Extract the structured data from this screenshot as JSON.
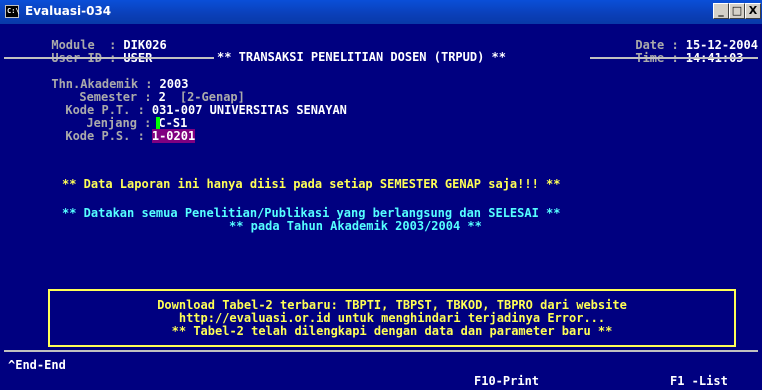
{
  "window": {
    "title": "Evaluasi-034",
    "icon_text": "C:\\",
    "minimize": "_",
    "maximize": "□",
    "close": "X"
  },
  "header": {
    "module_label": "Module  :",
    "module_value": "DIK026",
    "user_label": "User ID :",
    "user_value": "USER",
    "date_label": "Date :",
    "date_value": "15-12-2004",
    "time_label": "Time :",
    "time_value": "14:41:03",
    "screen_title": "** TRANSAKSI PENELITIAN DOSEN (TRPUD) **"
  },
  "form": {
    "thn_label": "Thn.Akademik :",
    "thn_value": "2003",
    "semester_label": "Semester :",
    "semester_value": "2",
    "semester_desc": "[2-Genap]",
    "kode_pt_label": "Kode P.T. :",
    "kode_pt_value": "031-007 UNIVERSITAS SENAYAN",
    "jenjang_label": "Jenjang :",
    "jenjang_value": "C-S1",
    "kode_ps_label": "Kode P.S. :",
    "kode_ps_value_first": "1",
    "kode_ps_value_rest": "-0201"
  },
  "messages": {
    "line1": "** Data Laporan ini hanya diisi pada setiap SEMESTER GENAP saja!!! **",
    "line2": "** Datakan semua Penelitian/Publikasi yang berlangsung dan SELESAI **",
    "line3": "** pada Tahun Akademik 2003/2004 **"
  },
  "notice": {
    "line1": "Download Tabel-2 terbaru: TBPTI, TBPST, TBKOD, TBPRO dari website",
    "line2": "http://evaluasi.or.id untuk menghindari terjadinya Error...",
    "line3": "** Tabel-2 telah dilengkapi dengan data dan parameter baru **"
  },
  "footer": {
    "end_key": "^End-End",
    "print_key": "F10-Print",
    "list_key": "F1 -List"
  },
  "colors": {
    "console_bg": "#000080",
    "label": "#aaaaaa",
    "value": "#ffffff",
    "highlight": "#ffff55",
    "title_bar": "#0a4fd8"
  }
}
